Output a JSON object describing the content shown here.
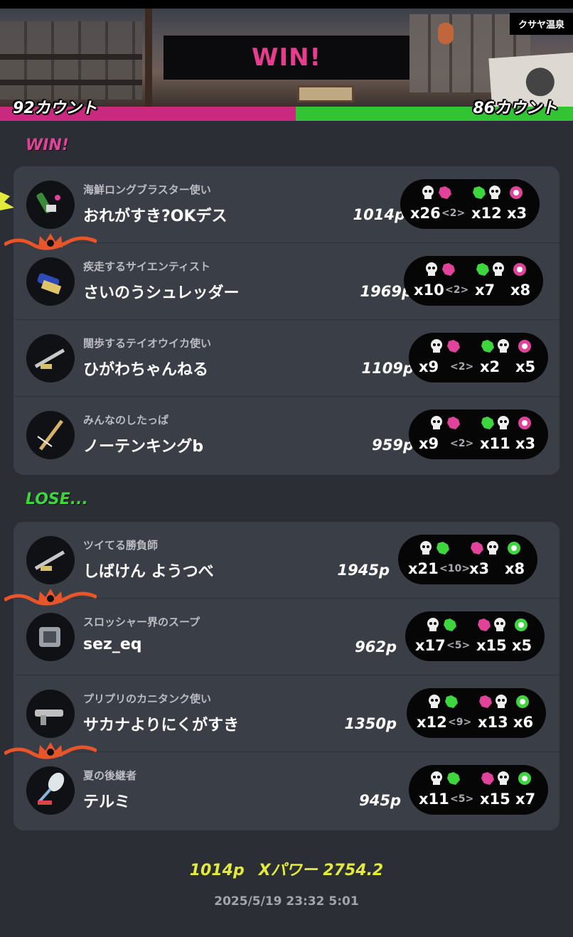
{
  "header": {
    "stage": "クサヤ温泉",
    "result": "WIN!",
    "alpha_count": "92カウント",
    "bravo_count": "86カウント",
    "alpha_color": "#c9297f",
    "bravo_color": "#33c433"
  },
  "win_section": {
    "label": "WIN!",
    "players": [
      {
        "title": "海鮮ロングブラスター使い",
        "name": "おれがすき?OKデス",
        "points": "1014p",
        "kills": "x26",
        "assists": "<2>",
        "deaths": "x12",
        "specials": "x3",
        "weapon_icon": "long-blaster-icon",
        "special_icon": "special-icon",
        "crown": false
      },
      {
        "title": "疾走するサイエンティスト",
        "name": "さいのうシュレッダー",
        "points": "1969p",
        "kills": "x10",
        "assists": "<2>",
        "deaths": "x7",
        "specials": "x8",
        "weapon_icon": "roller-icon",
        "special_icon": "special-icon",
        "crown": true
      },
      {
        "title": "闊歩するテイオウイカ使い",
        "name": "ひがわちゃんねる",
        "points": "1109p",
        "kills": "x9",
        "assists": "<2>",
        "deaths": "x2",
        "specials": "x5",
        "weapon_icon": "charger-icon",
        "special_icon": "special-icon",
        "crown": false
      },
      {
        "title": "みんなのしたっぱ",
        "name": "ノーテンキングb",
        "points": "959p",
        "kills": "x9",
        "assists": "<2>",
        "deaths": "x11",
        "specials": "x3",
        "weapon_icon": "stringer-icon",
        "special_icon": "special-icon",
        "crown": false
      }
    ]
  },
  "lose_section": {
    "label": "LOSE...",
    "players": [
      {
        "title": "ツイてる勝負師",
        "name": "しばけん ようつべ",
        "points": "1945p",
        "kills": "x21",
        "assists": "<10>",
        "deaths": "x3",
        "specials": "x8",
        "weapon_icon": "charger-icon",
        "special_icon": "special-icon",
        "crown": false
      },
      {
        "title": "スロッシャー界のスープ",
        "name": "sez_eq",
        "points": "962p",
        "kills": "x17",
        "assists": "<5>",
        "deaths": "x15",
        "specials": "x5",
        "weapon_icon": "slosher-icon",
        "special_icon": "special-icon",
        "crown": true
      },
      {
        "title": "プリプリのカニタンク使い",
        "name": "サカナよりにくがすき",
        "points": "1350p",
        "kills": "x12",
        "assists": "<9>",
        "deaths": "x13",
        "specials": "x6",
        "weapon_icon": "shooter-icon",
        "special_icon": "special-icon",
        "crown": false
      },
      {
        "title": "夏の後継者",
        "name": "テルミ",
        "points": "945p",
        "kills": "x11",
        "assists": "<5>",
        "deaths": "x15",
        "specials": "x7",
        "weapon_icon": "brush-icon",
        "special_icon": "special-icon",
        "crown": true
      }
    ]
  },
  "footer": {
    "points": "1014p",
    "power": "Xパワー 2754.2",
    "datetime": "2025/5/19 23:32 5:01"
  }
}
